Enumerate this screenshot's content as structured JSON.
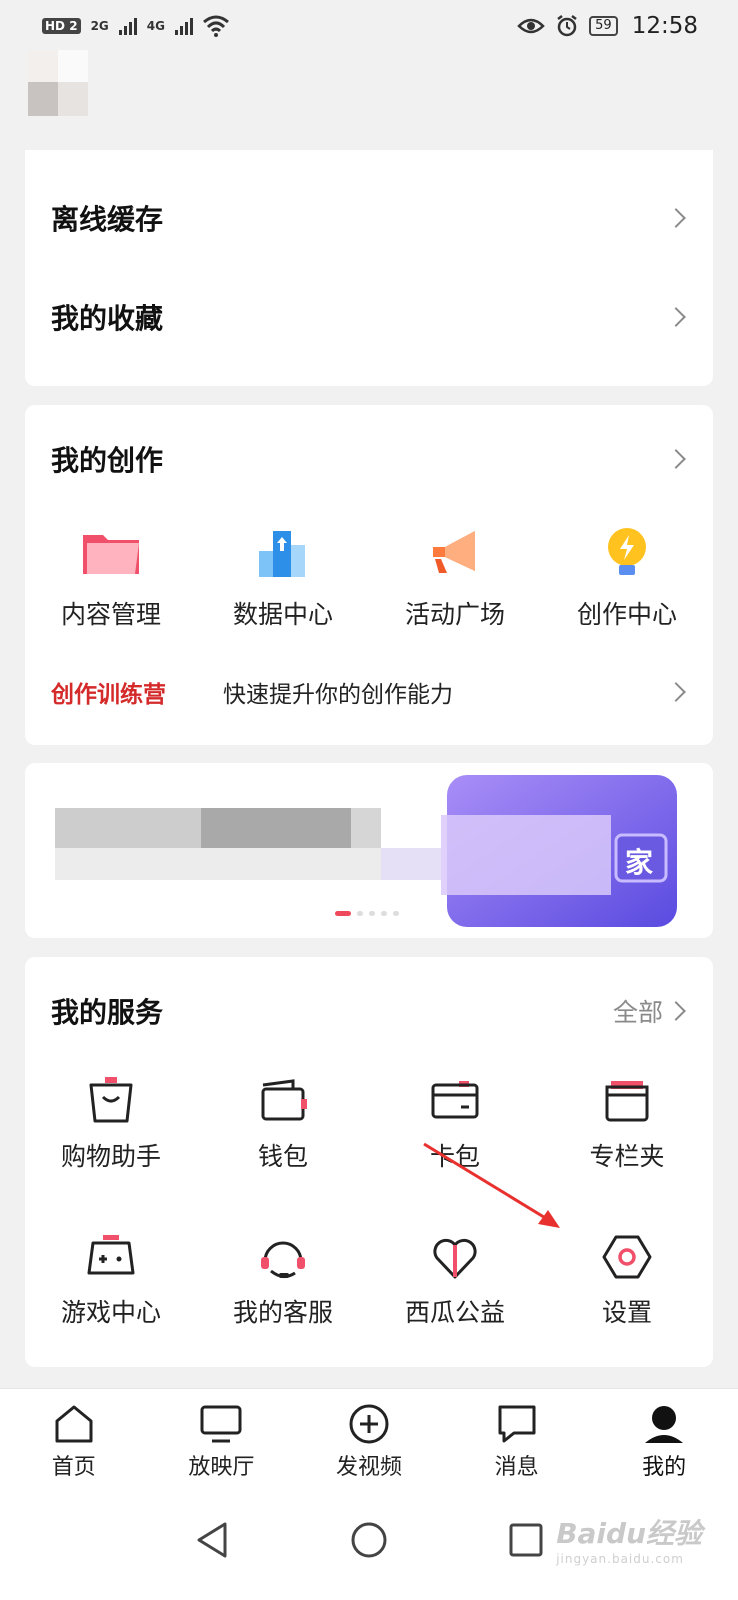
{
  "status_bar": {
    "hd_badge": "HD",
    "hd_sub": "2",
    "signal_1": "2G",
    "signal_2": "4G",
    "battery": "59",
    "time": "12:58"
  },
  "list_card": {
    "items": [
      {
        "label": "离线缓存",
        "icon": "chevron-right-icon"
      },
      {
        "label": "我的收藏",
        "icon": "chevron-right-icon"
      }
    ]
  },
  "creation": {
    "title": "我的创作",
    "items": [
      {
        "label": "内容管理",
        "icon": "folder-icon"
      },
      {
        "label": "数据中心",
        "icon": "data-chart-icon"
      },
      {
        "label": "活动广场",
        "icon": "megaphone-icon"
      },
      {
        "label": "创作中心",
        "icon": "lightbulb-icon"
      }
    ],
    "camp_label": "创作训练营",
    "camp_text": "快速提升你的创作能力"
  },
  "banner": {
    "image_text": "家",
    "dots": [
      true,
      false,
      false,
      false,
      false
    ]
  },
  "services": {
    "title": "我的服务",
    "all_label": "全部",
    "items": [
      {
        "label": "购物助手",
        "icon": "shopping-bag-icon"
      },
      {
        "label": "钱包",
        "icon": "wallet-icon"
      },
      {
        "label": "卡包",
        "icon": "card-icon"
      },
      {
        "label": "专栏夹",
        "icon": "column-folder-icon"
      },
      {
        "label": "游戏中心",
        "icon": "gamepad-icon"
      },
      {
        "label": "我的客服",
        "icon": "headset-icon"
      },
      {
        "label": "西瓜公益",
        "icon": "heart-icon"
      },
      {
        "label": "设置",
        "icon": "settings-hex-icon"
      }
    ]
  },
  "tabs": [
    {
      "label": "首页",
      "icon": "home-icon",
      "active": false
    },
    {
      "label": "放映厅",
      "icon": "tv-icon",
      "active": false
    },
    {
      "label": "发视频",
      "icon": "plus-circle-icon",
      "active": false
    },
    {
      "label": "消息",
      "icon": "message-icon",
      "active": false
    },
    {
      "label": "我的",
      "icon": "profile-icon",
      "active": true
    }
  ],
  "watermark": {
    "brand": "Baidu经验",
    "domain": "jingyan.baidu.com"
  },
  "colors": {
    "accent_red": "#d42a2a",
    "dot_active": "#ef4a5b",
    "arrow_red": "#e8312e"
  }
}
